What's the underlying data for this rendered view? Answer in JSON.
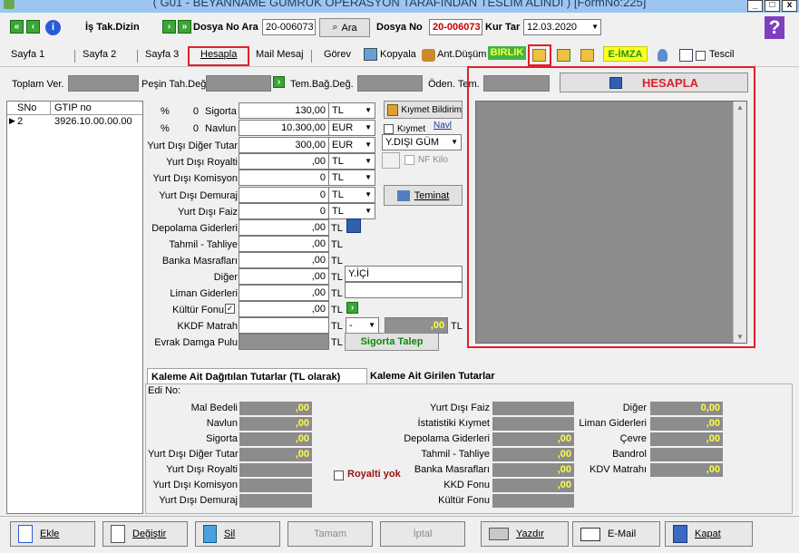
{
  "window": {
    "title": "( G01 - BEYANNAME GÜMRÜK OPERASYON TARAFINDAN TESLİM ALINDI ) [FormNo:225]",
    "min": "_",
    "max": "□",
    "close": "x"
  },
  "toolbar1": {
    "is_tak": "İş Tak.Dizin",
    "dosya_no_ara": "Dosya No Ara",
    "dosya_no_ara_value": "20-006073",
    "ara": "Ara",
    "dosya_no": "Dosya No",
    "dosya_no_value": "20-006073",
    "kur_tar": "Kur Tar",
    "kur_tar_value": "12.03.2020",
    "help": "?"
  },
  "tabs": {
    "sayfa1": "Sayfa 1",
    "sayfa2": "Sayfa 2",
    "sayfa3": "Sayfa 3",
    "hesapla": "Hesapla",
    "mail": "Mail Mesaj",
    "gorev": "Görev",
    "kopyala": "Kopyala",
    "ant": "Ant.Düşüm",
    "birlik": "BIRLIK",
    "eimza": "E-İMZA",
    "tescil": "Tescil"
  },
  "summary": {
    "toplam_ver": "Toplam Ver.",
    "pesin": "Peşin Tah.Değ.",
    "tem_bag": "Tem.Bağ.Değ.",
    "oden_tem": "Öden. Tem.",
    "hesapla_btn": "HESAPLA"
  },
  "grid": {
    "col_sno": "SNo",
    "col_gtip": "GTIP no",
    "rows": [
      {
        "sno": "2",
        "gtip": "3926.10.00.00.00"
      }
    ]
  },
  "form": {
    "pct1": "%",
    "pct1_val": "0",
    "sigorta": "Sigorta",
    "sigorta_val": "130,00",
    "sigorta_cur": "TL",
    "pct2": "%",
    "pct2_val": "0",
    "navlun": "Navlun",
    "navlun_val": "10.300,00",
    "navlun_cur": "EUR",
    "yd_diger": "Yurt Dışı Diğer Tutar",
    "yd_diger_val": "300,00",
    "yd_diger_cur": "EUR",
    "yd_royalti": "Yurt Dışı Royalti",
    "yd_royalti_val": ",00",
    "yd_royalti_cur": "TL",
    "yd_komisyon": "Yurt Dışı Komisyon",
    "yd_komisyon_val": "0",
    "yd_komisyon_cur": "TL",
    "yd_demuraj": "Yurt Dışı Demuraj",
    "yd_demuraj_val": "0",
    "yd_demuraj_cur": "TL",
    "yd_faiz": "Yurt Dışı Faiz",
    "yd_faiz_val": "0",
    "yd_faiz_cur": "TL",
    "depolama": "Depolama Giderleri",
    "depolama_val": ",00",
    "depolama_cur": "TL",
    "tahmil": "Tahmil - Tahliye",
    "tahmil_val": ",00",
    "tahmil_cur": "TL",
    "banka": "Banka Masrafları",
    "banka_val": ",00",
    "banka_cur": "TL",
    "diger": "Diğer",
    "diger_val": ",00",
    "diger_cur": "TL",
    "diger_extra": "Y.İÇİ",
    "liman": "Liman Giderleri",
    "liman_val": ",00",
    "liman_cur": "TL",
    "kultur": "Kültür Fonu",
    "kultur_val": ",00",
    "kultur_cur": "TL",
    "kkdf": "KKDF Matrah",
    "kkdf_cur": "TL",
    "kkdf_sel": "-",
    "kkdf_amount": ",00",
    "kkdf_amount_cur": "TL",
    "evrak": "Evrak Damga Pulu",
    "evrak_cur": "TL",
    "kiymet_bildirim": "Kıymet Bildirim",
    "kiymet": "Kıymet",
    "navi": "Navl",
    "ydisi_gum": "Y.DIŞI GÜM",
    "nf_kilo": "NF Kilo",
    "teminat": "Teminat",
    "sigorta_talep": "Sigorta Talep"
  },
  "bottom_tabs": {
    "tab1": "Kaleme Ait Dağıtılan Tutarlar (TL olarak)",
    "tab2": "Kaleme Ait Girilen Tutarlar"
  },
  "bottom": {
    "edi_no": "Edi No:",
    "c1": [
      {
        "label": "Mal Bedeli",
        "value": ",00"
      },
      {
        "label": "Navlun",
        "value": ",00"
      },
      {
        "label": "Sigorta",
        "value": ",00"
      },
      {
        "label": "Yurt Dışı Diğer Tutar",
        "value": ",00"
      },
      {
        "label": "Yurt Dışı Royalti",
        "value": ""
      },
      {
        "label": "Yurt Dışı Komisyon",
        "value": ""
      },
      {
        "label": "Yurt Dışı Demuraj",
        "value": ""
      }
    ],
    "royalti_yok": "Royalti yok",
    "c2": [
      {
        "label": "Yurt Dışı Faiz",
        "value": ""
      },
      {
        "label": "İstatistiki Kıymet",
        "value": ""
      },
      {
        "label": "Depolama Giderleri",
        "value": ",00"
      },
      {
        "label": "Tahmil - Tahliye",
        "value": ",00"
      },
      {
        "label": "Banka Masrafları",
        "value": ",00"
      },
      {
        "label": "KKD Fonu",
        "value": ",00"
      },
      {
        "label": "Kültür Fonu",
        "value": ""
      }
    ],
    "c3": [
      {
        "label": "Diğer",
        "value": "0,00"
      },
      {
        "label": "Liman Giderleri",
        "value": ",00"
      },
      {
        "label": "Çevre",
        "value": ",00"
      },
      {
        "label": "Bandrol",
        "value": ""
      },
      {
        "label": "KDV Matrahı",
        "value": ",00"
      }
    ]
  },
  "buttons": {
    "ekle": "Ekle",
    "degistir": "Değiştir",
    "sil": "Sil",
    "tamam": "Tamam",
    "iptal": "İptal",
    "yazdir": "Yazdır",
    "email": "E-Mail",
    "kapat": "Kapat"
  }
}
